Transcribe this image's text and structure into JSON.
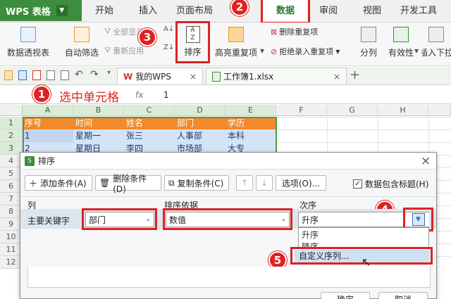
{
  "app": {
    "name": "WPS 表格"
  },
  "menu_tabs": [
    "开始",
    "插入",
    "页面布局",
    "数据",
    "审阅",
    "视图",
    "开发工具"
  ],
  "ribbon": {
    "pivot": "数据透视表",
    "autofilter": "自动筛选",
    "show_all": "全部显示",
    "reapply": "重新应用",
    "sort_asc": "A↓",
    "sort_desc": "Z↓",
    "sort": "排序",
    "highlight_dup": "高亮重复项",
    "remove_dup": "删除重复项",
    "reject_dup": "拒绝录入重复项",
    "split": "分列",
    "validity": "有效性",
    "dropdown": "插入下拉"
  },
  "doc_tabs": {
    "wps": "我的WPS",
    "file": "工作簿1.xlsx"
  },
  "formula_bar": {
    "fx": "fx",
    "value": "1",
    "annotation": "选中单元格"
  },
  "grid": {
    "columns": [
      "A",
      "B",
      "C",
      "D",
      "E",
      "F",
      "G",
      "H"
    ],
    "rows": [
      "1",
      "2",
      "3",
      "4",
      "5",
      "6",
      "7",
      "8",
      "9",
      "10",
      "11",
      "12"
    ],
    "header": [
      "序号",
      "时间",
      "姓名",
      "部门",
      "学历"
    ],
    "row2": [
      "1",
      "星期一",
      "张三",
      "人事部",
      "本科"
    ],
    "row3": [
      "2",
      "星期日",
      "李四",
      "市场部",
      "大专"
    ]
  },
  "dialog": {
    "title": "排序",
    "close": "×",
    "add_condition": "添加条件(A)",
    "delete_condition": "删除条件(D)",
    "copy_condition": "复制条件(C)",
    "up_arrow": "↑",
    "down_arrow": "↓",
    "options": "选项(O)...",
    "has_header": "数据包含标题(H)",
    "col_header": "列",
    "basis_header": "排序依据",
    "order_header": "次序",
    "primary_key_label": "主要关键字",
    "primary_key_value": "部门",
    "basis_value": "数值",
    "order_value": "升序",
    "order_options": [
      "升序",
      "降序",
      "自定义序列..."
    ],
    "ok": "确定",
    "cancel": "取消"
  },
  "steps": [
    "1",
    "2",
    "3",
    "4",
    "5"
  ],
  "colors": {
    "accent": "#3c8d3c",
    "highlight": "#d22222",
    "header_fill": "#f08a2c",
    "data_fill": "#d4e3f6"
  }
}
